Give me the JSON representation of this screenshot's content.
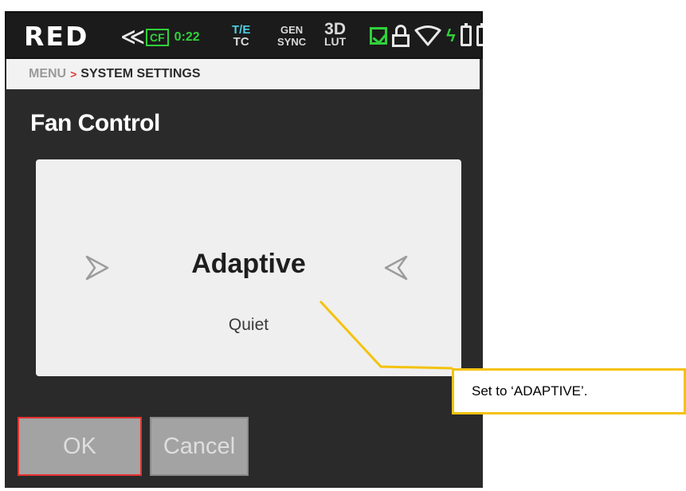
{
  "status_bar": {
    "logo": "RED",
    "back_icon": "chevron-left-icon",
    "media_label": "CF",
    "media_time": "0:22",
    "te_top": "T/E",
    "te_bottom": "TC",
    "gen_top": "GEN",
    "gen_bottom": "SYNC",
    "lut_top": "3D",
    "lut_bottom": "LUT",
    "icons": [
      "checkbox-checked-icon",
      "lock-open-icon",
      "wifi-icon",
      "bolt-icon",
      "battery-icon",
      "battery-icon"
    ],
    "accent_color": "#30d13b",
    "te_color": "#4ccfe0"
  },
  "breadcrumb": {
    "parent": "MENU",
    "separator": ">",
    "current": "SYSTEM SETTINGS"
  },
  "page": {
    "title": "Fan Control"
  },
  "selector": {
    "selected_value": "Adaptive",
    "next_option": "Quiet",
    "prev_icon": "arrow-left-icon",
    "next_icon": "arrow-right-icon"
  },
  "buttons": {
    "ok_label": "OK",
    "cancel_label": "Cancel",
    "ok_border_color": "#e4322e"
  },
  "annotation": {
    "text": "Set to ‘ADAPTIVE’.",
    "color": "#f4c20d"
  }
}
